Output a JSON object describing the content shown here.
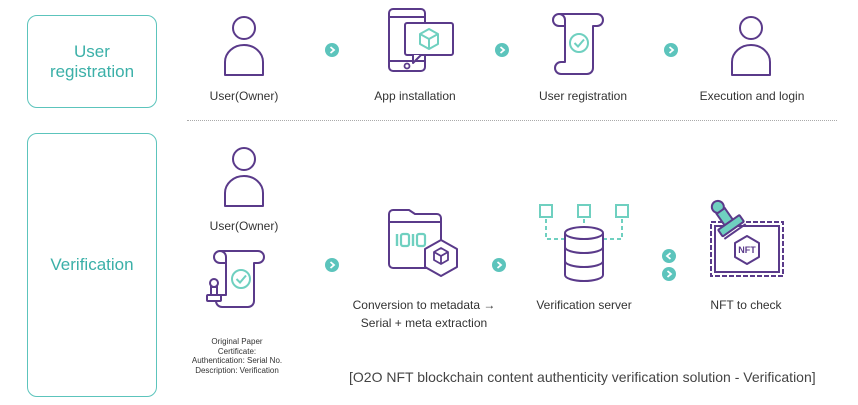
{
  "sections": {
    "registration": {
      "title_line1": "User",
      "title_line2": "registration"
    },
    "verification": {
      "title": "Verification"
    }
  },
  "registration_steps": [
    {
      "label": "User(Owner)",
      "icon": "user-icon"
    },
    {
      "label": "App installation",
      "icon": "phone-app-icon"
    },
    {
      "label": "User registration",
      "icon": "document-check-icon"
    },
    {
      "label": "Execution and login",
      "icon": "user-icon"
    }
  ],
  "verification_steps": {
    "user": {
      "label": "User(Owner)",
      "icon": "user-icon"
    },
    "certificate": {
      "icon": "certificate-stamp-icon",
      "note": [
        "Original Paper",
        "Certificate:",
        "Authentication: Serial No.",
        "Description: Verification"
      ]
    },
    "conversion": {
      "label_line1": "Conversion to metadata →",
      "label_line2": "Serial + meta extraction",
      "icon": "folder-binary-icon"
    },
    "server": {
      "label": "Verification server",
      "icon": "database-icon"
    },
    "nft": {
      "label": "NFT to check",
      "icon": "nft-stamp-icon",
      "badge": "NFT"
    }
  },
  "caption": "[O2O NFT blockchain content authenticity verification solution - Verification]",
  "colors": {
    "teal": "#5cc4bc",
    "purple": "#5a3a8a",
    "mint": "#6fd0c0"
  }
}
